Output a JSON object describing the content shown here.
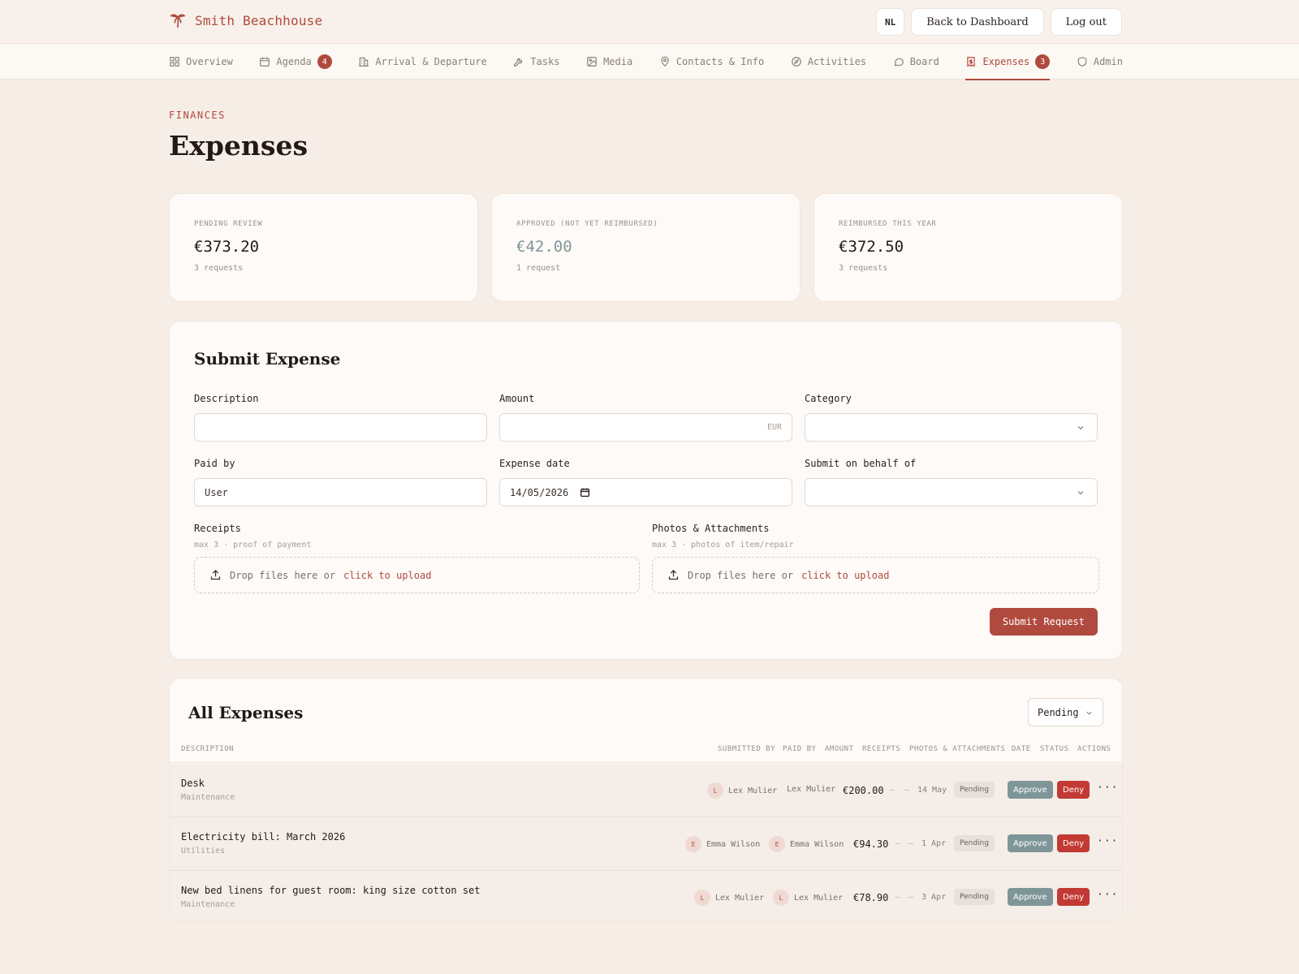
{
  "header": {
    "brand": "Smith Beachhouse",
    "lang": "NL",
    "back_label": "Back to Dashboard",
    "logout_label": "Log out"
  },
  "nav": {
    "items": [
      {
        "label": "Overview",
        "icon": "grid-icon"
      },
      {
        "label": "Agenda",
        "icon": "calendar-icon",
        "badge": "4"
      },
      {
        "label": "Arrival & Departure",
        "icon": "building-icon"
      },
      {
        "label": "Tasks",
        "icon": "wrench-icon"
      },
      {
        "label": "Media",
        "icon": "image-icon"
      },
      {
        "label": "Contacts & Info",
        "icon": "map-pin-icon"
      },
      {
        "label": "Activities",
        "icon": "compass-icon"
      },
      {
        "label": "Board",
        "icon": "message-icon"
      },
      {
        "label": "Expenses",
        "icon": "receipt-icon",
        "badge": "3",
        "active": true
      },
      {
        "label": "Admin",
        "icon": "shield-icon"
      }
    ]
  },
  "page": {
    "eyebrow": "FINANCES",
    "title": "Expenses"
  },
  "stats": [
    {
      "label": "PENDING REVIEW",
      "value": "€373.20",
      "sub": "3 requests"
    },
    {
      "label": "APPROVED (NOT YET REIMBURSED)",
      "value": "€42.00",
      "sub": "1 request"
    },
    {
      "label": "REIMBURSED THIS YEAR",
      "value": "€372.50",
      "sub": "3 requests"
    }
  ],
  "form": {
    "title": "Submit Expense",
    "description_label": "Description",
    "description_value": "",
    "amount_label": "Amount",
    "amount_suffix": "EUR",
    "category_label": "Category",
    "paid_by_label": "Paid by",
    "paid_by_value": "User",
    "date_label": "Expense date",
    "date_value": "14/05/2026",
    "behalf_label": "Submit on behalf of",
    "receipts_label": "Receipts",
    "receipts_hint": "max 3 · proof of payment",
    "photos_label": "Photos & Attachments",
    "photos_hint": "max 3 · photos of item/repair",
    "drop_text": "Drop files here or",
    "drop_link": "click to upload",
    "submit_label": "Submit Request"
  },
  "list": {
    "title": "All Expenses",
    "filter_value": "Pending",
    "columns": {
      "description": "DESCRIPTION",
      "submitted_by": "SUBMITTED BY",
      "paid_by": "PAID BY",
      "amount": "AMOUNT",
      "receipts": "RECEIPTS",
      "photos": "PHOTOS & ATTACHMENTS",
      "date": "DATE",
      "status": "STATUS",
      "actions": "ACTIONS"
    },
    "rows": [
      {
        "description": "Desk",
        "category": "Maintenance",
        "submitted_initial": "L",
        "submitted_by": "Lex Mulier",
        "paid_by": "Lex Mulier",
        "amount": "€200.00",
        "receipts": "–",
        "photos": "–",
        "date": "14 May",
        "status": "Pending",
        "approve": "Approve",
        "deny": "Deny",
        "more": "···"
      },
      {
        "description": "Electricity bill: March 2026",
        "category": "Utilities",
        "submitted_initial": "E",
        "submitted_by": "Emma Wilson",
        "paid_initial": "E",
        "paid_by": "Emma Wilson",
        "amount": "€94.30",
        "receipts": "–",
        "photos": "–",
        "date": "1 Apr",
        "status": "Pending",
        "approve": "Approve",
        "deny": "Deny",
        "more": "···"
      },
      {
        "description": "New bed linens for guest room: king size cotton set",
        "category": "Maintenance",
        "submitted_initial": "L",
        "submitted_by": "Lex Mulier",
        "paid_initial": "L",
        "paid_by": "Lex Mulier",
        "amount": "€78.90",
        "receipts": "–",
        "photos": "–",
        "date": "3 Apr",
        "status": "Pending",
        "approve": "Approve",
        "deny": "Deny",
        "more": "···"
      }
    ]
  },
  "colors": {
    "accent": "#b04a3e",
    "approve": "#7f9699",
    "deny": "#c23a33",
    "background": "#f6ede6"
  }
}
